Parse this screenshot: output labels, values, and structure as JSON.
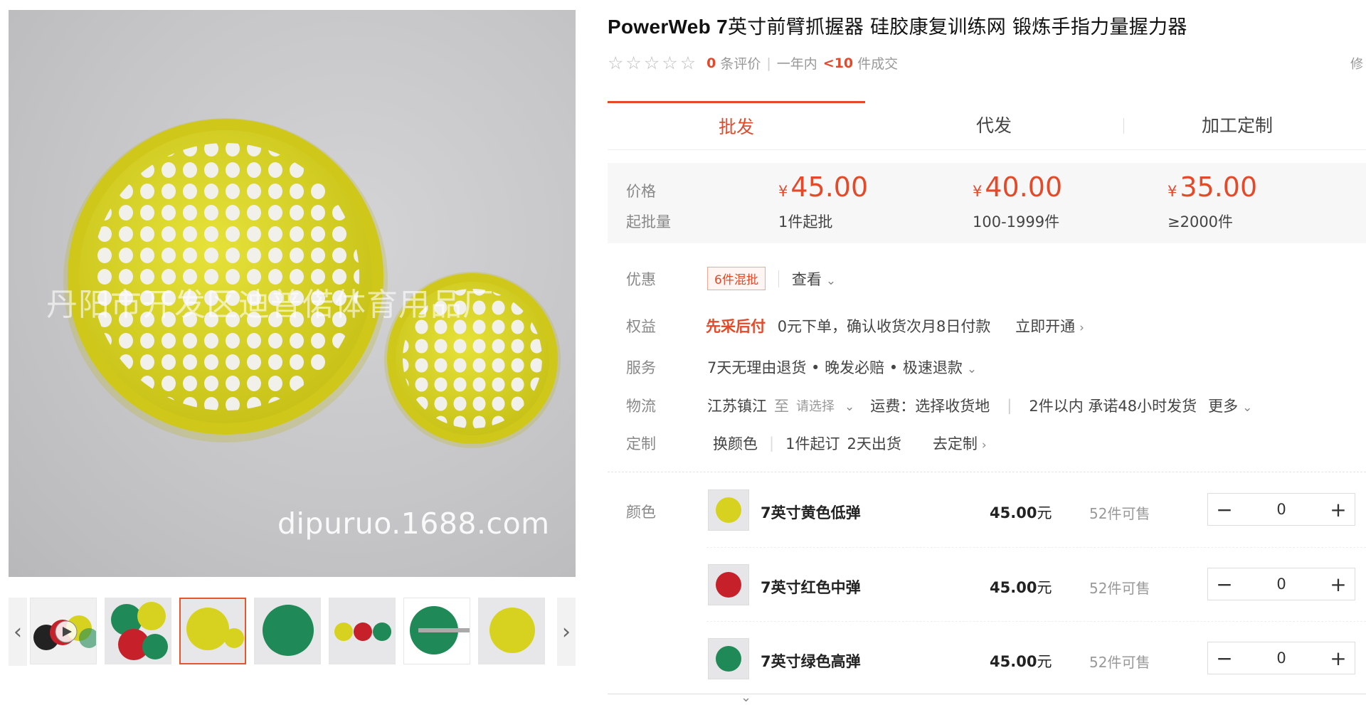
{
  "gallery": {
    "watermark_company": "丹阳市开发区迪普偌体育用品厂",
    "watermark_site": "dipuruo.1688.com",
    "prev_icon": "chevron-left-icon",
    "next_icon": "chevron-right-icon",
    "thumbnails": [
      "video",
      "multi",
      "yellow",
      "green",
      "yellow-red-green",
      "green-ruler",
      "yellow-single"
    ]
  },
  "product": {
    "title_brand": "PowerWeb 7",
    "title_rest": "英寸前臂抓握器 硅胶康复训练网 锻炼手指力量握力器",
    "reviews_count": "0",
    "reviews_label": "条评价",
    "period_label": "一年内",
    "deals_count": "<10",
    "deals_label": "件成交",
    "cut_right": "修"
  },
  "tabs": [
    {
      "label": "批发"
    },
    {
      "label": "代发"
    },
    {
      "label": "加工定制"
    }
  ],
  "pricing": {
    "price_label": "价格",
    "moq_label": "起批量",
    "currency": "¥",
    "tiers": [
      {
        "price": "45.00",
        "qty": "1件起批"
      },
      {
        "price": "40.00",
        "qty": "100-1999件"
      },
      {
        "price": "35.00",
        "qty": "≥2000件"
      }
    ]
  },
  "promo": {
    "label": "优惠",
    "tag": "6件混批",
    "view": "查看"
  },
  "rights": {
    "label": "权益",
    "highlight": "先采后付",
    "desc": "0元下单，确认收货次月8日付款",
    "action": "立即开通"
  },
  "service": {
    "label": "服务",
    "text": "7天无理由退货 • 晚发必赔 • 极速退款"
  },
  "logistics": {
    "label": "物流",
    "from": "江苏镇江",
    "to": "至",
    "select": "请选择",
    "fee": "运费：选择收货地",
    "ship": "2件以内 承诺48小时发货",
    "more": "更多"
  },
  "custom": {
    "label": "定制",
    "color": "换颜色",
    "moq": "1件起订",
    "days": "2天出货",
    "action": "去定制"
  },
  "sku": {
    "label": "颜色",
    "items": [
      {
        "name": "7英寸黄色低弹",
        "price": "45.00",
        "unit": "元",
        "stock": "52件可售",
        "qty": "0",
        "color": "#d7d21f"
      },
      {
        "name": "7英寸红色中弹",
        "price": "45.00",
        "unit": "元",
        "stock": "52件可售",
        "qty": "0",
        "color": "#c6202a"
      },
      {
        "name": "7英寸绿色高弹",
        "price": "45.00",
        "unit": "元",
        "stock": "52件可售",
        "qty": "0",
        "color": "#1f8a57"
      }
    ]
  },
  "colors": {
    "accent": "#e4492a",
    "muted": "#888888"
  }
}
